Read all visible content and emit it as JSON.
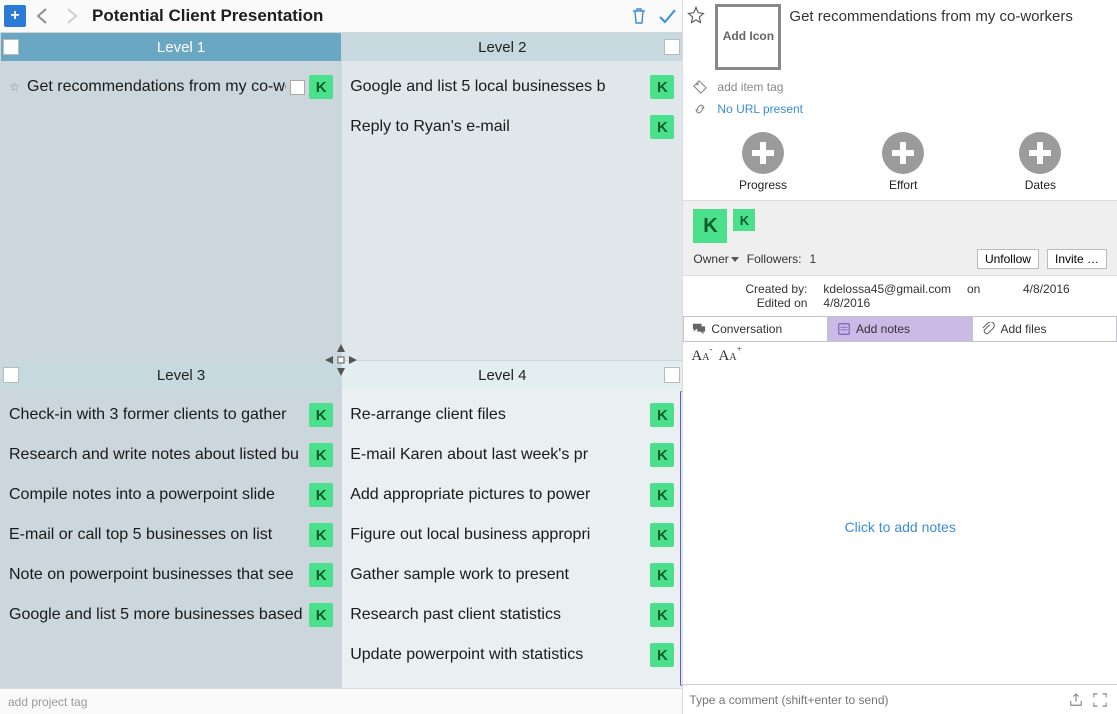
{
  "toolbar": {
    "title": "Potential Client Presentation"
  },
  "quadrants": {
    "level1": {
      "title": "Level 1",
      "tasks": [
        {
          "text": "Get recommendations from my co-workers",
          "avatar": "K"
        }
      ]
    },
    "level2": {
      "title": "Level 2",
      "tasks": [
        {
          "text": "Google and list 5 local businesses b",
          "avatar": "K"
        },
        {
          "text": "Reply to Ryan's e-mail",
          "avatar": "K"
        }
      ]
    },
    "level3": {
      "title": "Level 3",
      "tasks": [
        {
          "text": "Check-in with 3 former clients to gather",
          "avatar": "K"
        },
        {
          "text": "Research and write notes about listed bu",
          "avatar": "K"
        },
        {
          "text": "Compile notes into a powerpoint slide",
          "avatar": "K"
        },
        {
          "text": "E-mail or call top 5 businesses on list",
          "avatar": "K"
        },
        {
          "text": "Note on powerpoint businesses that see",
          "avatar": "K"
        },
        {
          "text": "Google and list 5 more businesses based",
          "avatar": "K"
        }
      ]
    },
    "level4": {
      "title": "Level 4",
      "tasks": [
        {
          "text": "Re-arrange client files",
          "avatar": "K"
        },
        {
          "text": "E-mail Karen about last week's pr",
          "avatar": "K"
        },
        {
          "text": "Add appropriate pictures to power",
          "avatar": "K"
        },
        {
          "text": "Figure out local business appropri",
          "avatar": "K"
        },
        {
          "text": "Gather sample work to present",
          "avatar": "K"
        },
        {
          "text": "Research past client statistics",
          "avatar": "K"
        },
        {
          "text": "Update powerpoint with statistics",
          "avatar": "K"
        }
      ]
    }
  },
  "footer": {
    "add_project_tag": "add project tag"
  },
  "detail": {
    "add_icon_label": "Add Icon",
    "title": "Get recommendations from my co-workers",
    "add_item_tag": "add item tag",
    "no_url": "No URL present",
    "adds": {
      "progress": "Progress",
      "effort": "Effort",
      "dates": "Dates"
    },
    "owner": {
      "owner_avatar": "K",
      "follower_avatar": "K",
      "owner_label": "Owner",
      "followers_label": "Followers:",
      "follower_count": "1",
      "unfollow": "Unfollow",
      "invite": "Invite …"
    },
    "created": {
      "created_by_label": "Created by:",
      "created_by_value": "kdelossa45@gmail.com",
      "on_label": "on",
      "created_date": "4/8/2016",
      "edited_label": "Edited on",
      "edited_date": "4/8/2016"
    },
    "tabs": {
      "conversation": "Conversation",
      "add_notes": "Add notes",
      "add_files": "Add files"
    },
    "notes_placeholder": "Click to add notes",
    "comment_placeholder": "Type a comment (shift+enter to send)"
  }
}
